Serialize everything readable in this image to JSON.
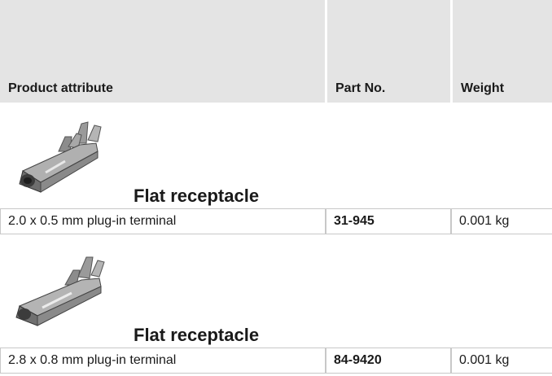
{
  "header": {
    "col_attribute": "Product attribute",
    "col_part": "Part No.",
    "col_weight": "Weight"
  },
  "products": [
    {
      "name": "Flat receptacle",
      "attribute": "2.0 x 0.5 mm plug-in terminal",
      "part_no": "31-945",
      "weight": "0.001 kg"
    },
    {
      "name": "Flat receptacle",
      "attribute": "2.8 x 0.8 mm plug-in terminal",
      "part_no": "84-9420",
      "weight": "0.001 kg"
    }
  ]
}
